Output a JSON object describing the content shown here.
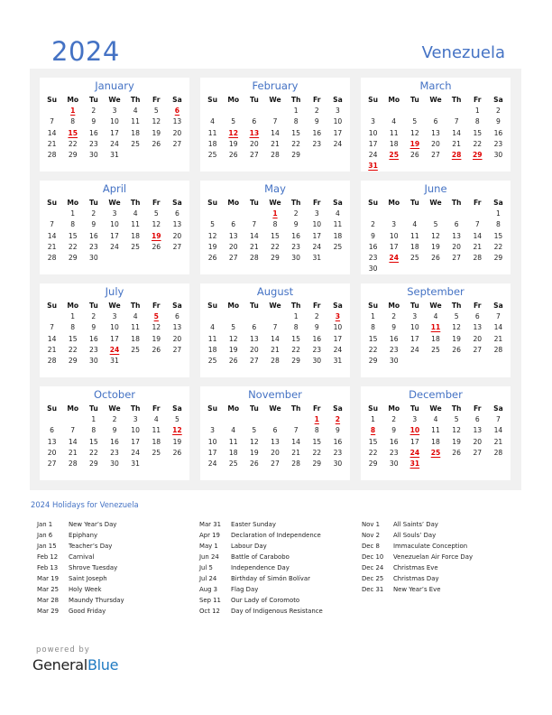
{
  "header": {
    "year": "2024",
    "country": "Venezuela"
  },
  "weekday_labels": [
    "Su",
    "Mo",
    "Tu",
    "We",
    "Th",
    "Fr",
    "Sa"
  ],
  "months": [
    {
      "name": "January",
      "offset": 1,
      "days": 31,
      "holidays": [
        1,
        6,
        15
      ]
    },
    {
      "name": "February",
      "offset": 4,
      "days": 29,
      "holidays": [
        12,
        13
      ]
    },
    {
      "name": "March",
      "offset": 5,
      "days": 31,
      "holidays": [
        19,
        25,
        28,
        29,
        31
      ]
    },
    {
      "name": "April",
      "offset": 1,
      "days": 30,
      "holidays": [
        19
      ]
    },
    {
      "name": "May",
      "offset": 3,
      "days": 31,
      "holidays": [
        1
      ]
    },
    {
      "name": "June",
      "offset": 6,
      "days": 30,
      "holidays": [
        24
      ]
    },
    {
      "name": "July",
      "offset": 1,
      "days": 31,
      "holidays": [
        5,
        24
      ]
    },
    {
      "name": "August",
      "offset": 4,
      "days": 31,
      "holidays": [
        3
      ]
    },
    {
      "name": "September",
      "offset": 0,
      "days": 30,
      "holidays": [
        11
      ]
    },
    {
      "name": "October",
      "offset": 2,
      "days": 31,
      "holidays": [
        12
      ]
    },
    {
      "name": "November",
      "offset": 5,
      "days": 30,
      "holidays": [
        1,
        2
      ]
    },
    {
      "name": "December",
      "offset": 0,
      "days": 31,
      "holidays": [
        8,
        10,
        24,
        25,
        31
      ]
    }
  ],
  "holidays_title": "2024 Holidays for Venezuela",
  "holiday_columns": [
    [
      {
        "date": "Jan 1",
        "name": "New Year’s Day"
      },
      {
        "date": "Jan 6",
        "name": "Epiphany"
      },
      {
        "date": "Jan 15",
        "name": "Teacher’s Day"
      },
      {
        "date": "Feb 12",
        "name": "Carnival"
      },
      {
        "date": "Feb 13",
        "name": "Shrove Tuesday"
      },
      {
        "date": "Mar 19",
        "name": "Saint Joseph"
      },
      {
        "date": "Mar 25",
        "name": "Holy Week"
      },
      {
        "date": "Mar 28",
        "name": "Maundy Thursday"
      },
      {
        "date": "Mar 29",
        "name": "Good Friday"
      }
    ],
    [
      {
        "date": "Mar 31",
        "name": "Easter Sunday"
      },
      {
        "date": "Apr 19",
        "name": "Declaration of Independence"
      },
      {
        "date": "May 1",
        "name": "Labour Day"
      },
      {
        "date": "Jun 24",
        "name": "Battle of Carabobo"
      },
      {
        "date": "Jul 5",
        "name": "Independence Day"
      },
      {
        "date": "Jul 24",
        "name": "Birthday of Simón Bolívar"
      },
      {
        "date": "Aug 3",
        "name": "Flag Day"
      },
      {
        "date": "Sep 11",
        "name": "Our Lady of Coromoto"
      },
      {
        "date": "Oct 12",
        "name": "Day of Indigenous Resistance"
      }
    ],
    [
      {
        "date": "Nov 1",
        "name": "All Saints’ Day"
      },
      {
        "date": "Nov 2",
        "name": "All Souls’ Day"
      },
      {
        "date": "Dec 8",
        "name": "Immaculate Conception"
      },
      {
        "date": "Dec 10",
        "name": "Venezuelan Air Force Day"
      },
      {
        "date": "Dec 24",
        "name": "Christmas Eve"
      },
      {
        "date": "Dec 25",
        "name": "Christmas Day"
      },
      {
        "date": "Dec 31",
        "name": "New Year’s Eve"
      }
    ]
  ],
  "footer": {
    "powered_by": "powered by",
    "brand_general": "General",
    "brand_blue": "Blue"
  },
  "colors": {
    "accent": "#4472c4",
    "holiday": "#e00000",
    "panel": "#f1f1f1",
    "brand_blue": "#1f7ac2"
  }
}
